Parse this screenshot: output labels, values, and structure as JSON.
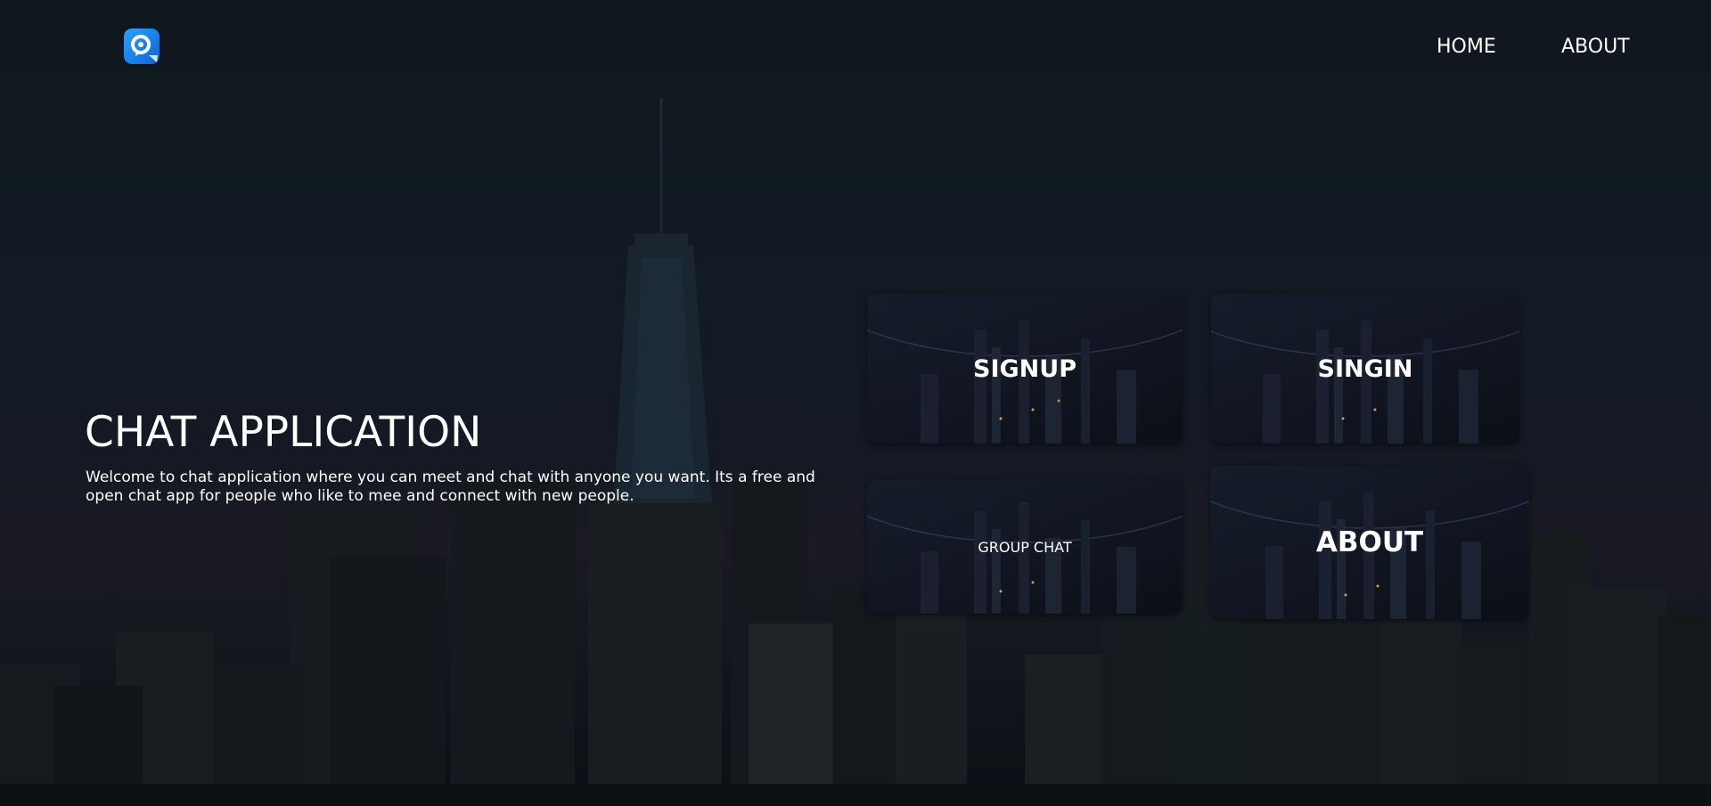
{
  "header": {
    "logo_icon": "chat-location-pin-icon",
    "nav": {
      "home_label": "HOME",
      "about_label": "ABOUT"
    }
  },
  "hero": {
    "title": "CHAT APPLICATION",
    "description": "Welcome to chat application where you can meet and chat with anyone you want. Its a free and open chat app for people who like to mee and connect with new people."
  },
  "cards": {
    "signup_label": "SIGNUP",
    "signin_label": "SINGIN",
    "group_chat_label": "GROUP CHAT",
    "about_label": "ABOUT"
  },
  "colors": {
    "accent_blue": "#1a8cff",
    "text": "#ffffff",
    "background": "#17212b"
  }
}
